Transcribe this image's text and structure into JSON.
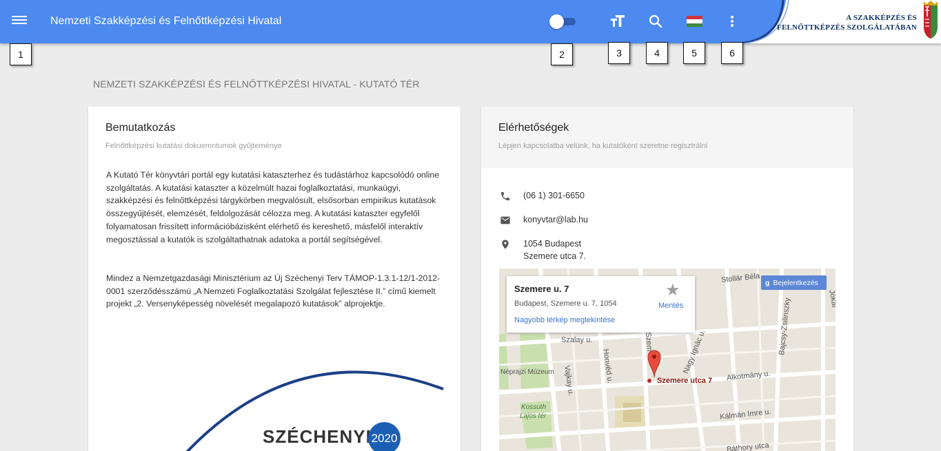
{
  "header": {
    "title": "Nemzeti Szakképzési és Felnőttképzési Hivatal",
    "logo_line1": "A SZAKKÉPZÉS ÉS",
    "logo_line2": "FELNŐTTKÉPZÉS SZOLGÁLATÁBAN",
    "toggle_on": false,
    "accent_color": "#4d8af0"
  },
  "callouts": [
    "1",
    "2",
    "3",
    "4",
    "5",
    "6"
  ],
  "page_heading": "NEMZETI SZAKKÉPZÉSI ÉS FELNŐTTKÉPZÉSI HIVATAL - KUTATÓ TÉR",
  "intro": {
    "title": "Bemutatkozás",
    "subtitle": "Felnőttképzési kutatási dokuemntumok gyűjteménye",
    "paragraph1": "A Kutató Tér könyvtári portál egy kutatási kataszterhez és tudástárhoz kapcsolódó online szolgáltatás. A kutatási kataszter a közelmúlt hazai foglalkoztatási, munkaügyi, szakképzési és felnőttképzési tárgykörben megvalósult, elsősorban empirikus kutatások összegyűjtését, elemzését, feldolgozását célozza meg. A kutatási kataszter egyfelől folyamatosan frissített információbázisként elérhető és kereshető, másfelől interaktív megosztással a kutatók is szolgáltathatnak adatoka a portál segítségével.",
    "paragraph2": "Mindez a Nemzetgazdasági Minisztérium az Új Széchenyi Terv TÁMOP-1.3.1-12/1-2012-0001 szerződésszámú „A Nemzeti Foglalkoztatási Szolgálat fejlesztése II.” című kiemelt projekt „2. Versenyképesség növelését megalapozó kutatások” alprojektje.",
    "logo_word": "SZÉCHENYI",
    "logo_year": "2020"
  },
  "contact": {
    "title": "Elérhetőségek",
    "subtitle": "Lépjen kapcsolatba velünk, ha kutatóként szeretne regisztrálni",
    "phone": "(06 1) 301-6650",
    "email": "konyvtar@lab.hu",
    "address_line1": "1054 Budapest",
    "address_line2": "Szemere utca 7."
  },
  "map": {
    "place_name": "Szemere u. 7",
    "place_address": "Budapest, Szemere u. 7, 1054",
    "save_label": "Mentés",
    "larger_map_link": "Nagyobb térkép megtekintése",
    "signin_label": "Bejelentkezés",
    "marker_label": "Szemere utca 7",
    "streets": {
      "stollar": "Stollár Béla",
      "szalay": "Szalay u.",
      "vajkay": "Vajkay u.",
      "honved": "Honvéd u.",
      "szemere": "Szem",
      "nagy_ignac": "Nagy Ignác u.",
      "bajcsy": "Bajcsy-Zsilinszky",
      "jokai": "Jókai",
      "alkotmany": "Alkotmány u.",
      "kalman_imre": "Kálmán Imre u.",
      "bathory": "Báthory utca",
      "kossuth1": "Kossuth",
      "kossuth2": "Lajos tér",
      "neprajzi": "Néprajzi Múzeum"
    }
  }
}
